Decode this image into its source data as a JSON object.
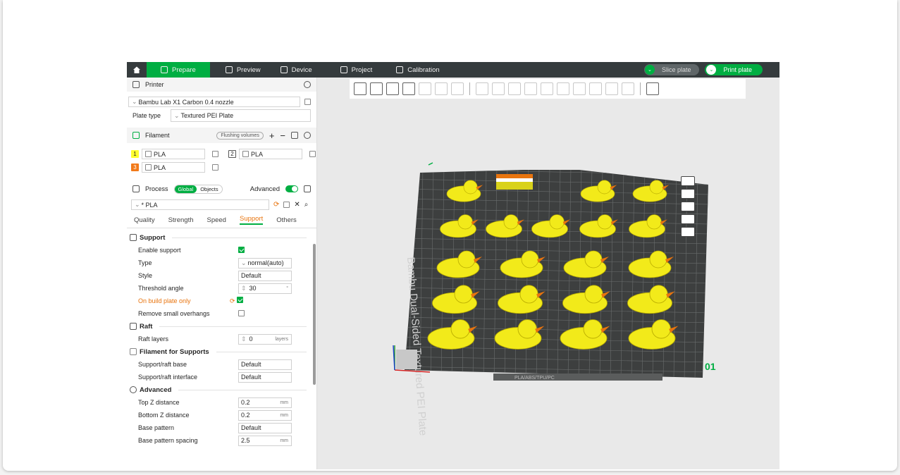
{
  "topbar": {
    "tabs": [
      {
        "label": "Prepare",
        "icon": "cube-icon",
        "active": true
      },
      {
        "label": "Preview",
        "icon": "layers-icon",
        "active": false
      },
      {
        "label": "Device",
        "icon": "device-icon",
        "active": false
      },
      {
        "label": "Project",
        "icon": "project-icon",
        "active": false
      },
      {
        "label": "Calibration",
        "icon": "calibration-icon",
        "active": false
      }
    ],
    "slice_label": "Slice plate",
    "print_label": "Print plate"
  },
  "printer": {
    "title": "Printer",
    "model": "Bambu Lab X1 Carbon 0.4 nozzle",
    "plate_type_label": "Plate type",
    "plate_type_value": "Textured PEI Plate"
  },
  "filament": {
    "title": "Filament",
    "flushing_label": "Flushing volumes",
    "slots": [
      {
        "index": "1",
        "name": "PLA",
        "color": "#ffff2e"
      },
      {
        "index": "2",
        "name": "PLA",
        "color": "#ffffff"
      },
      {
        "index": "3",
        "name": "PLA",
        "color": "#f27a1a"
      }
    ]
  },
  "process": {
    "title": "Process",
    "global_label": "Global",
    "objects_label": "Objects",
    "advanced_label": "Advanced",
    "preset": "* PLA",
    "tabs": [
      "Quality",
      "Strength",
      "Speed",
      "Support",
      "Others"
    ],
    "active_tab": "Support"
  },
  "support": {
    "group_support": "Support",
    "enable_support_label": "Enable support",
    "type_label": "Type",
    "type_value": "normal(auto)",
    "style_label": "Style",
    "style_value": "Default",
    "threshold_label": "Threshold angle",
    "threshold_value": "30",
    "threshold_unit": "°",
    "build_plate_only_label": "On build plate only",
    "remove_small_label": "Remove small overhangs",
    "group_raft": "Raft",
    "raft_layers_label": "Raft layers",
    "raft_layers_value": "0",
    "raft_layers_unit": "layers",
    "group_filament": "Filament for Supports",
    "base_label": "Support/raft base",
    "base_value": "Default",
    "interface_label": "Support/raft interface",
    "interface_value": "Default",
    "group_advanced": "Advanced",
    "top_z_label": "Top Z distance",
    "top_z_value": "0.2",
    "bottom_z_label": "Bottom Z distance",
    "bottom_z_value": "0.2",
    "base_pattern_label": "Base pattern",
    "base_pattern_value": "Default",
    "spacing_label": "Base pattern spacing",
    "spacing_value": "2.5",
    "mm": "mm"
  },
  "plate": {
    "label": "Bambu Dual-Sided Textured PEI Plate",
    "number": "01",
    "material_label": "PLA/ABS/TPU/PC",
    "duck_count": 20,
    "colors": {
      "plate": "#3d3f3f",
      "grid": "#6a6d6d",
      "duck": "#f2ea1a",
      "beak": "#e8740e",
      "accent": "#00ae42"
    }
  }
}
